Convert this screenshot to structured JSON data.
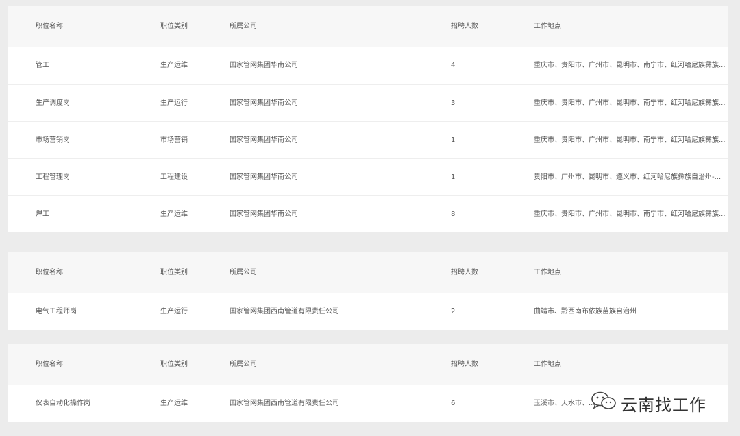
{
  "columns": [
    "职位名称",
    "职位类别",
    "所属公司",
    "招聘人数",
    "工作地点"
  ],
  "tables": [
    {
      "rows": [
        [
          "管工",
          "生产运维",
          "国家管网集团华南公司",
          "4",
          "重庆市、贵阳市、广州市、昆明市、南宁市、红河哈尼族彝族..."
        ],
        [
          "生产调度岗",
          "生产运行",
          "国家管网集团华南公司",
          "3",
          "重庆市、贵阳市、广州市、昆明市、南宁市、红河哈尼族彝族..."
        ],
        [
          "市场营销岗",
          "市场营销",
          "国家管网集团华南公司",
          "1",
          "重庆市、贵阳市、广州市、昆明市、南宁市、红河哈尼族彝族..."
        ],
        [
          "工程管理岗",
          "工程建设",
          "国家管网集团华南公司",
          "1",
          "贵阳市、广州市、昆明市、遵义市、红河哈尼族彝族自治州-..."
        ],
        [
          "焊工",
          "生产运维",
          "国家管网集团华南公司",
          "8",
          "重庆市、贵阳市、广州市、昆明市、南宁市、红河哈尼族彝族..."
        ]
      ]
    },
    {
      "rows": [
        [
          "电气工程师岗",
          "生产运行",
          "国家管网集团西南管道有限责任公司",
          "2",
          "曲靖市、黔西南布依族苗族自治州"
        ]
      ]
    },
    {
      "rows": [
        [
          "仪表自动化操作岗",
          "生产运维",
          "国家管网集团西南管道有限责任公司",
          "6",
          "玉溪市、天水市、..."
        ]
      ]
    }
  ],
  "watermark": {
    "text": "云南找工作",
    "icon": "wechat-icon"
  }
}
